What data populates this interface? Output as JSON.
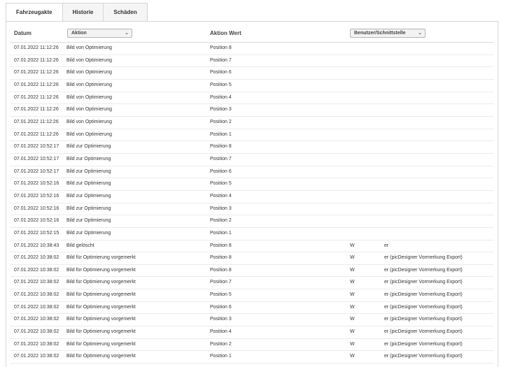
{
  "tabs": [
    {
      "label": "Fahrzeugakte",
      "active": true
    },
    {
      "label": "Historie",
      "active": false
    },
    {
      "label": "Schäden",
      "active": false
    }
  ],
  "columns": {
    "datum": "Datum",
    "aktion": "Aktion",
    "aktion_wert": "Aktion Wert",
    "benutzer": "Benutzer/Schnittstelle"
  },
  "rows": [
    {
      "datum": "07.01.2022 11:12:26",
      "aktion": "Bild von Optimierung",
      "wert": "Position 8",
      "user": "",
      "iface": ""
    },
    {
      "datum": "07.01.2022 11:12:26",
      "aktion": "Bild von Optimierung",
      "wert": "Position 7",
      "user": "",
      "iface": ""
    },
    {
      "datum": "07.01.2022 11:12:26",
      "aktion": "Bild von Optimierung",
      "wert": "Position 6",
      "user": "",
      "iface": ""
    },
    {
      "datum": "07.01.2022 11:12:26",
      "aktion": "Bild von Optimierung",
      "wert": "Position 5",
      "user": "",
      "iface": ""
    },
    {
      "datum": "07.01.2022 11:12:26",
      "aktion": "Bild von Optimierung",
      "wert": "Position 4",
      "user": "",
      "iface": ""
    },
    {
      "datum": "07.01.2022 11:12:26",
      "aktion": "Bild von Optimierung",
      "wert": "Position 3",
      "user": "",
      "iface": ""
    },
    {
      "datum": "07.01.2022 11:12:26",
      "aktion": "Bild von Optimierung",
      "wert": "Position 2",
      "user": "",
      "iface": ""
    },
    {
      "datum": "07.01.2022 11:12:26",
      "aktion": "Bild von Optimierung",
      "wert": "Position 1",
      "user": "",
      "iface": ""
    },
    {
      "datum": "07.01.2022 10:52:17",
      "aktion": "Bild zur Optimierung",
      "wert": "Position 8",
      "user": "",
      "iface": ""
    },
    {
      "datum": "07.01.2022 10:52:17",
      "aktion": "Bild zur Optimierung",
      "wert": "Position 7",
      "user": "",
      "iface": ""
    },
    {
      "datum": "07.01.2022 10:52:17",
      "aktion": "Bild zur Optimierung",
      "wert": "Position 6",
      "user": "",
      "iface": ""
    },
    {
      "datum": "07.01.2022 10:52:16",
      "aktion": "Bild zur Optimierung",
      "wert": "Position 5",
      "user": "",
      "iface": ""
    },
    {
      "datum": "07.01.2022 10:52:16",
      "aktion": "Bild zur Optimierung",
      "wert": "Position 4",
      "user": "",
      "iface": ""
    },
    {
      "datum": "07.01.2022 10:52:16",
      "aktion": "Bild zur Optimierung",
      "wert": "Position 3",
      "user": "",
      "iface": ""
    },
    {
      "datum": "07.01.2022 10:52:16",
      "aktion": "Bild zur Optimierung",
      "wert": "Position 2",
      "user": "",
      "iface": ""
    },
    {
      "datum": "07.01.2022 10:52:15",
      "aktion": "Bild zur Optimierung",
      "wert": "Position 1",
      "user": "",
      "iface": ""
    },
    {
      "datum": "07.01.2022 10:38:43",
      "aktion": "Bild gelöscht",
      "wert": "Position 8",
      "user": "W",
      "iface": "er"
    },
    {
      "datum": "07.01.2022 10:38:02",
      "aktion": "Bild für Optimierung vorgemerkt",
      "wert": "Position 8",
      "user": "W",
      "iface": "er (picDesigner Vormerkung Export)"
    },
    {
      "datum": "07.01.2022 10:38:02",
      "aktion": "Bild für Optimierung vorgemerkt",
      "wert": "Position 8",
      "user": "W",
      "iface": "er (picDesigner Vormerkung Export)"
    },
    {
      "datum": "07.01.2022 10:38:02",
      "aktion": "Bild für Optimierung vorgemerkt",
      "wert": "Position 7",
      "user": "W",
      "iface": "er (picDesigner Vormerkung Export)"
    },
    {
      "datum": "07.01.2022 10:38:02",
      "aktion": "Bild für Optimierung vorgemerkt",
      "wert": "Position 5",
      "user": "W",
      "iface": "er (picDesigner Vormerkung Export)"
    },
    {
      "datum": "07.01.2022 10:38:02",
      "aktion": "Bild für Optimierung vorgemerkt",
      "wert": "Position 6",
      "user": "W",
      "iface": "er (picDesigner Vormerkung Export)"
    },
    {
      "datum": "07.01.2022 10:38:02",
      "aktion": "Bild für Optimierung vorgemerkt",
      "wert": "Position 3",
      "user": "W",
      "iface": "er (picDesigner Vormerkung Export)"
    },
    {
      "datum": "07.01.2022 10:38:02",
      "aktion": "Bild für Optimierung vorgemerkt",
      "wert": "Position 4",
      "user": "W",
      "iface": "er (picDesigner Vormerkung Export)"
    },
    {
      "datum": "07.01.2022 10:38:02",
      "aktion": "Bild für Optimierung vorgemerkt",
      "wert": "Position 2",
      "user": "W",
      "iface": "er (picDesigner Vormerkung Export)"
    },
    {
      "datum": "07.01.2022 10:38:02",
      "aktion": "Bild für Optimierung vorgemerkt",
      "wert": "Position 1",
      "user": "W",
      "iface": "er (picDesigner Vormerkung Export)"
    }
  ]
}
